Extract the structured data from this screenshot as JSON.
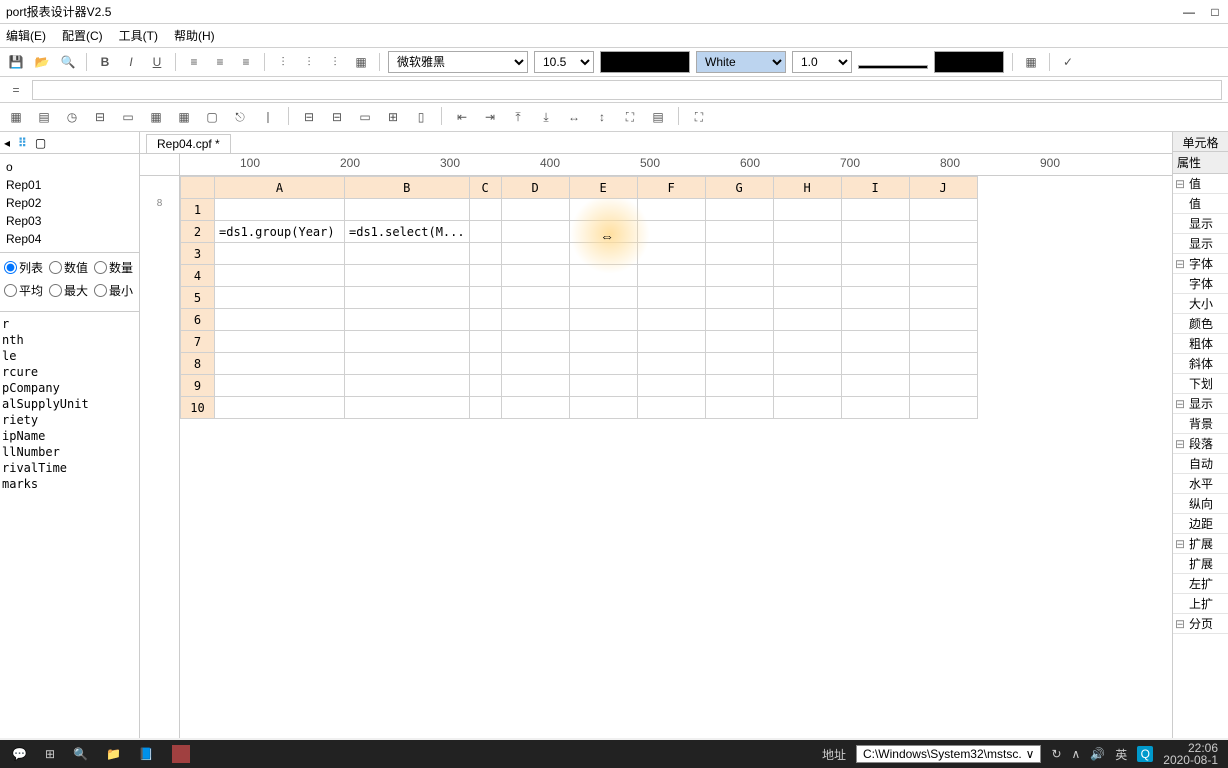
{
  "title": "port报表设计器V2.5",
  "menu": [
    "编辑(E)",
    "配置(C)",
    "工具(T)",
    "帮助(H)"
  ],
  "toolbar1": {
    "font": "微软雅黑",
    "size": "10.5",
    "fgcolor": "#000000",
    "bg_label": "White",
    "line_weight": "1.0"
  },
  "formula": "",
  "leftTabs": [
    "",
    "",
    ""
  ],
  "reports": [
    "o",
    "Rep01",
    "Rep02",
    "Rep03",
    "Rep04"
  ],
  "radios1": [
    "列表",
    "数值",
    "数量"
  ],
  "radios2": [
    "平均",
    "最大",
    "最小"
  ],
  "selectedRadio": "列表",
  "fields": [
    "r",
    "nth",
    "le",
    "rcure",
    "pCompany",
    "alSupplyUnit",
    "riety",
    "ipName",
    "llNumber",
    "rivalTime",
    "marks"
  ],
  "tab": "Rep04.cpf *",
  "rulerTicks": [
    "100",
    "200",
    "300",
    "400",
    "500",
    "600",
    "700",
    "800",
    "900"
  ],
  "columns": [
    "A",
    "B",
    "C",
    "D",
    "E",
    "F",
    "G",
    "H",
    "I",
    "J"
  ],
  "rows": [
    {
      "n": "1",
      "cells": [
        "",
        "",
        "",
        "",
        "",
        "",
        "",
        "",
        "",
        ""
      ]
    },
    {
      "n": "2",
      "cells": [
        "=ds1.group(Year)",
        "=ds1.select(M...",
        "",
        "",
        "",
        "",
        "",
        "",
        "",
        ""
      ]
    },
    {
      "n": "3",
      "cells": [
        "",
        "",
        "",
        "",
        "",
        "",
        "",
        "",
        "",
        ""
      ]
    },
    {
      "n": "4",
      "cells": [
        "",
        "",
        "",
        "",
        "",
        "",
        "",
        "",
        "",
        ""
      ]
    },
    {
      "n": "5",
      "cells": [
        "",
        "",
        "",
        "",
        "",
        "",
        "",
        "",
        "",
        ""
      ]
    },
    {
      "n": "6",
      "cells": [
        "",
        "",
        "",
        "",
        "",
        "",
        "",
        "",
        "",
        ""
      ]
    },
    {
      "n": "7",
      "cells": [
        "",
        "",
        "",
        "",
        "",
        "",
        "",
        "",
        "",
        ""
      ]
    },
    {
      "n": "8",
      "cells": [
        "",
        "",
        "",
        "",
        "",
        "",
        "",
        "",
        "",
        ""
      ]
    },
    {
      "n": "9",
      "cells": [
        "",
        "",
        "",
        "",
        "",
        "",
        "",
        "",
        "",
        ""
      ]
    },
    {
      "n": "10",
      "cells": [
        "",
        "",
        "",
        "",
        "",
        "",
        "",
        "",
        "",
        ""
      ]
    }
  ],
  "rightTab": "单元格",
  "rightHead": "属性",
  "props": [
    {
      "exp": "⊟",
      "label": "值"
    },
    {
      "exp": "",
      "label": "值"
    },
    {
      "exp": "",
      "label": "显示"
    },
    {
      "exp": "",
      "label": "显示"
    },
    {
      "exp": "⊟",
      "label": "字体"
    },
    {
      "exp": "",
      "label": "字体"
    },
    {
      "exp": "",
      "label": "大小"
    },
    {
      "exp": "",
      "label": "颜色"
    },
    {
      "exp": "",
      "label": "粗体"
    },
    {
      "exp": "",
      "label": "斜体"
    },
    {
      "exp": "",
      "label": "下划"
    },
    {
      "exp": "⊟",
      "label": "显示"
    },
    {
      "exp": "",
      "label": "背景"
    },
    {
      "exp": "⊟",
      "label": "段落"
    },
    {
      "exp": "",
      "label": "自动"
    },
    {
      "exp": "",
      "label": "水平"
    },
    {
      "exp": "",
      "label": "纵向"
    },
    {
      "exp": "",
      "label": "边距"
    },
    {
      "exp": "⊟",
      "label": "扩展"
    },
    {
      "exp": "",
      "label": "扩展"
    },
    {
      "exp": "",
      "label": "左扩"
    },
    {
      "exp": "",
      "label": "上扩"
    },
    {
      "exp": "⊟",
      "label": "分页"
    }
  ],
  "taskbar": {
    "address_label": "地址",
    "address": "C:\\Windows\\System32\\mstsc.",
    "ime": "英",
    "time": "22:06",
    "date": "2020-08-1"
  }
}
